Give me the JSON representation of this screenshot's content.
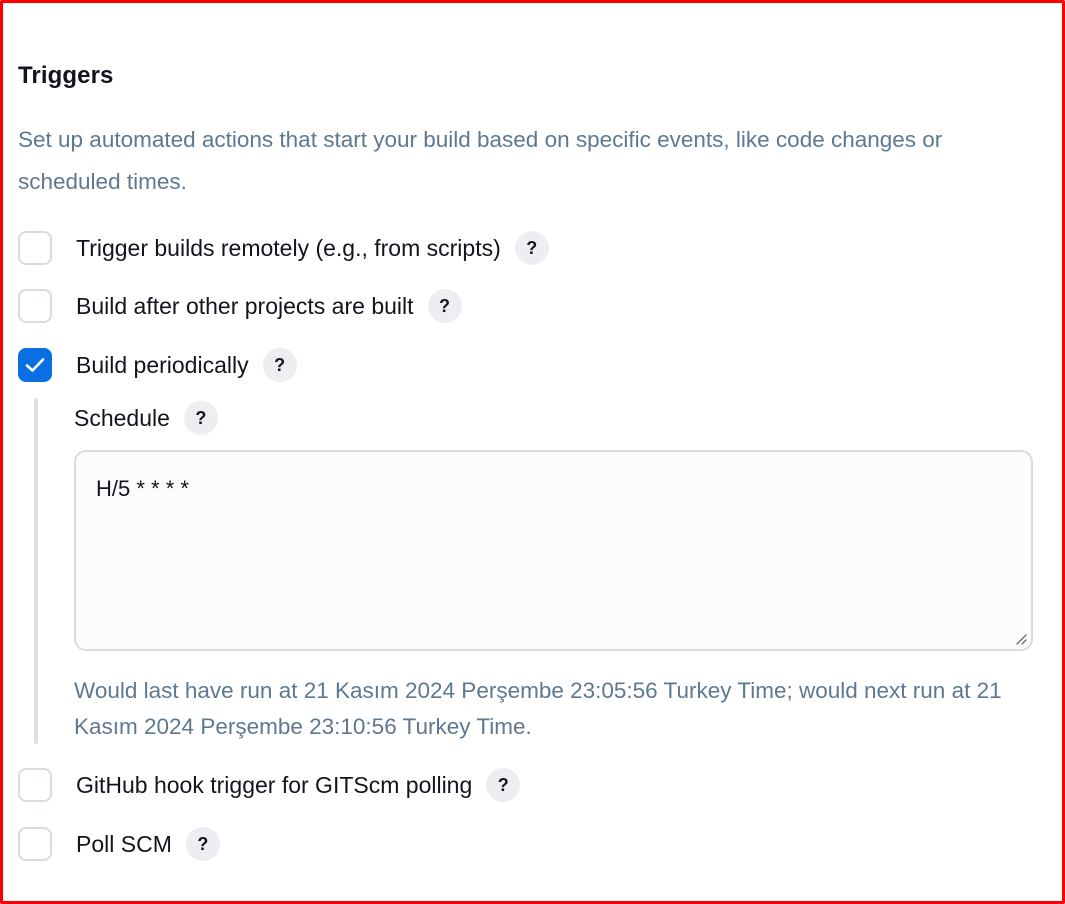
{
  "section": {
    "title": "Triggers",
    "description": "Set up automated actions that start your build based on specific events, like code changes or scheduled times."
  },
  "help_label": "?",
  "triggers": [
    {
      "label": "Trigger builds remotely (e.g., from scripts)",
      "checked": false
    },
    {
      "label": "Build after other projects are built",
      "checked": false
    },
    {
      "label": "Build periodically",
      "checked": true
    },
    {
      "label": "GitHub hook trigger for GITScm polling",
      "checked": false
    },
    {
      "label": "Poll SCM",
      "checked": false
    }
  ],
  "schedule": {
    "label": "Schedule",
    "value": "H/5 * * * *",
    "info": "Would last have run at 21 Kasım 2024 Perşembe 23:05:56 Turkey Time; would next run at 21 Kasım 2024 Perşembe 23:10:56 Turkey Time."
  },
  "colors": {
    "accent": "#0b6fe4",
    "description_text": "#5f7891",
    "frame": "#ff0000"
  },
  "icons": {
    "check": "checkmark-icon",
    "help": "help-icon",
    "resize": "resize-grip-icon"
  }
}
